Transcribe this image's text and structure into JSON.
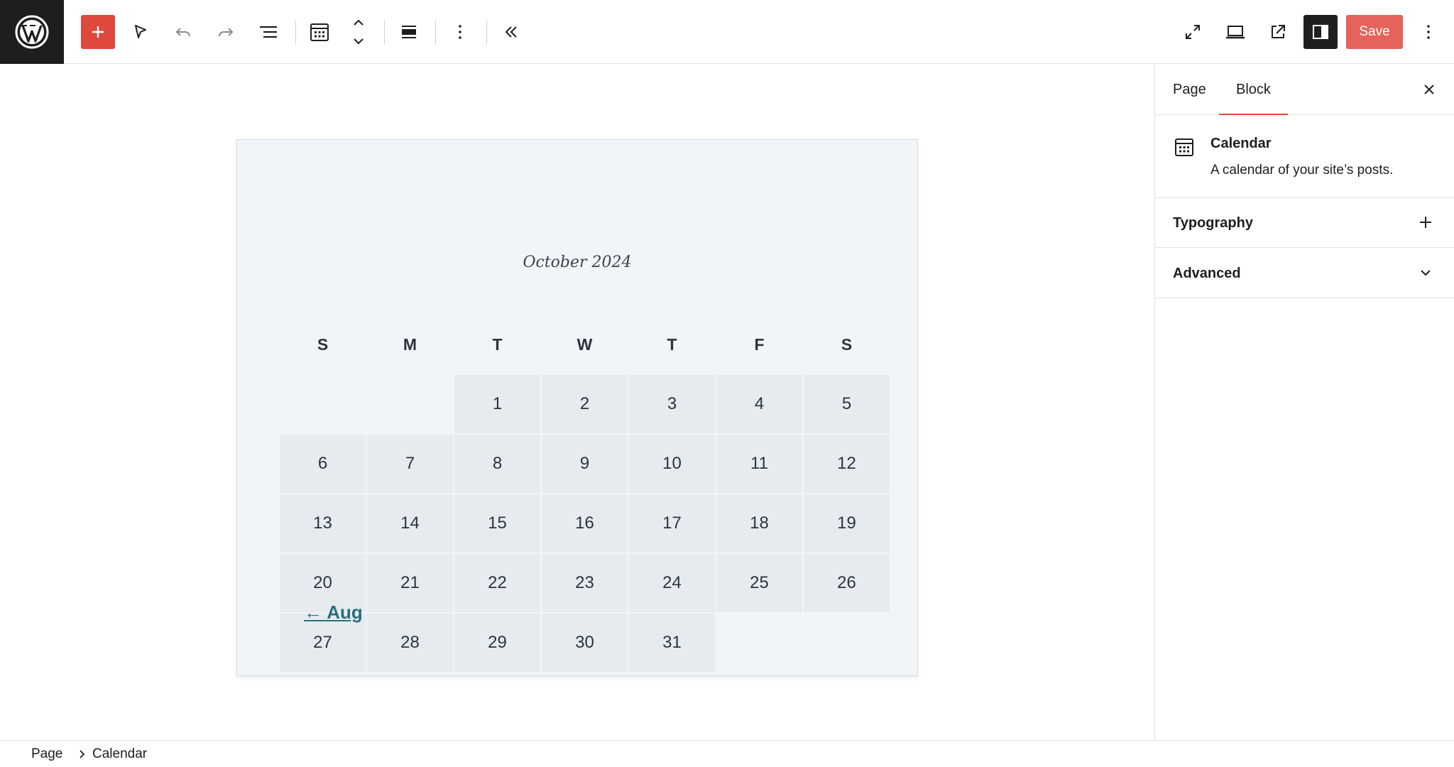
{
  "toolbar": {
    "save_label": "Save",
    "accent_color": "#e0483e"
  },
  "icons": {
    "logo": "wordpress-logo",
    "add": "plus-icon",
    "select": "pointer-icon",
    "undo": "undo-icon",
    "redo": "redo-icon",
    "list_view": "list-view-icon",
    "block_type": "calendar-icon",
    "move": "chevron-up-down-icon",
    "align": "align-icon",
    "options": "more-vertical-icon",
    "collapse": "chevrons-left-icon",
    "fullscreen": "fullscreen-icon",
    "device": "laptop-icon",
    "external": "external-link-icon",
    "settings": "sidebar-toggle-icon",
    "more": "more-vertical-icon"
  },
  "calendar": {
    "caption": "October 2024",
    "weekdays": [
      "S",
      "M",
      "T",
      "W",
      "T",
      "F",
      "S"
    ],
    "weeks": [
      [
        "",
        "",
        "1",
        "2",
        "3",
        "4",
        "5"
      ],
      [
        "6",
        "7",
        "8",
        "9",
        "10",
        "11",
        "12"
      ],
      [
        "13",
        "14",
        "15",
        "16",
        "17",
        "18",
        "19"
      ],
      [
        "20",
        "21",
        "22",
        "23",
        "24",
        "25",
        "26"
      ],
      [
        "27",
        "28",
        "29",
        "30",
        "31",
        "",
        ""
      ]
    ],
    "prev_link": "← Aug",
    "link_color": "#2a6f7d"
  },
  "sidebar": {
    "tabs": [
      {
        "label": "Page",
        "active": false
      },
      {
        "label": "Block",
        "active": true
      }
    ],
    "block": {
      "title": "Calendar",
      "description": "A calendar of your site’s posts."
    },
    "panels": [
      {
        "label": "Typography",
        "icon": "plus-icon"
      },
      {
        "label": "Advanced",
        "icon": "chevron-down-icon"
      }
    ]
  },
  "breadcrumb": [
    "Page",
    "Calendar"
  ]
}
